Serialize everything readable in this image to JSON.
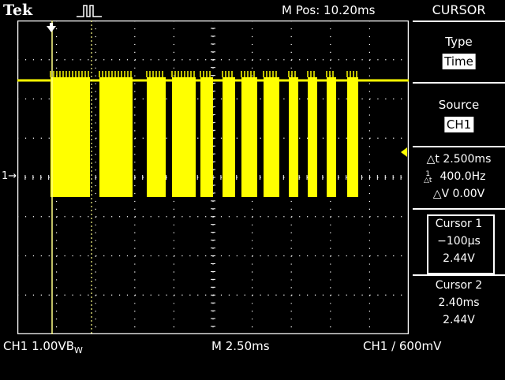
{
  "header": {
    "brand": "Tek",
    "trigger_icon": "pulse-trigger-icon",
    "m_pos": "M Pos: 10.20ms",
    "menu_title": "CURSOR"
  },
  "menu": {
    "type_label": "Type",
    "type_value": "Time",
    "source_label": "Source",
    "source_value": "CH1",
    "delta_t": "△t 2.500ms",
    "freq": "400.0Hz",
    "delta_v": "△V 0.00V",
    "cursor1_label": "Cursor 1",
    "cursor1_time": "−100µs",
    "cursor1_volt": "2.44V",
    "cursor2_label": "Cursor 2",
    "cursor2_time": "2.40ms",
    "cursor2_volt": "2.44V"
  },
  "status": {
    "ch1_scale": "CH1  1.00VB",
    "bw_suffix": "W",
    "timebase": "M 2.50ms",
    "trigger": "CH1 ∕ 600mV"
  },
  "markers": {
    "ch1": "1→"
  },
  "colors": {
    "trace": "#ffff00",
    "grid": "#ffffff",
    "background": "#000000"
  }
}
